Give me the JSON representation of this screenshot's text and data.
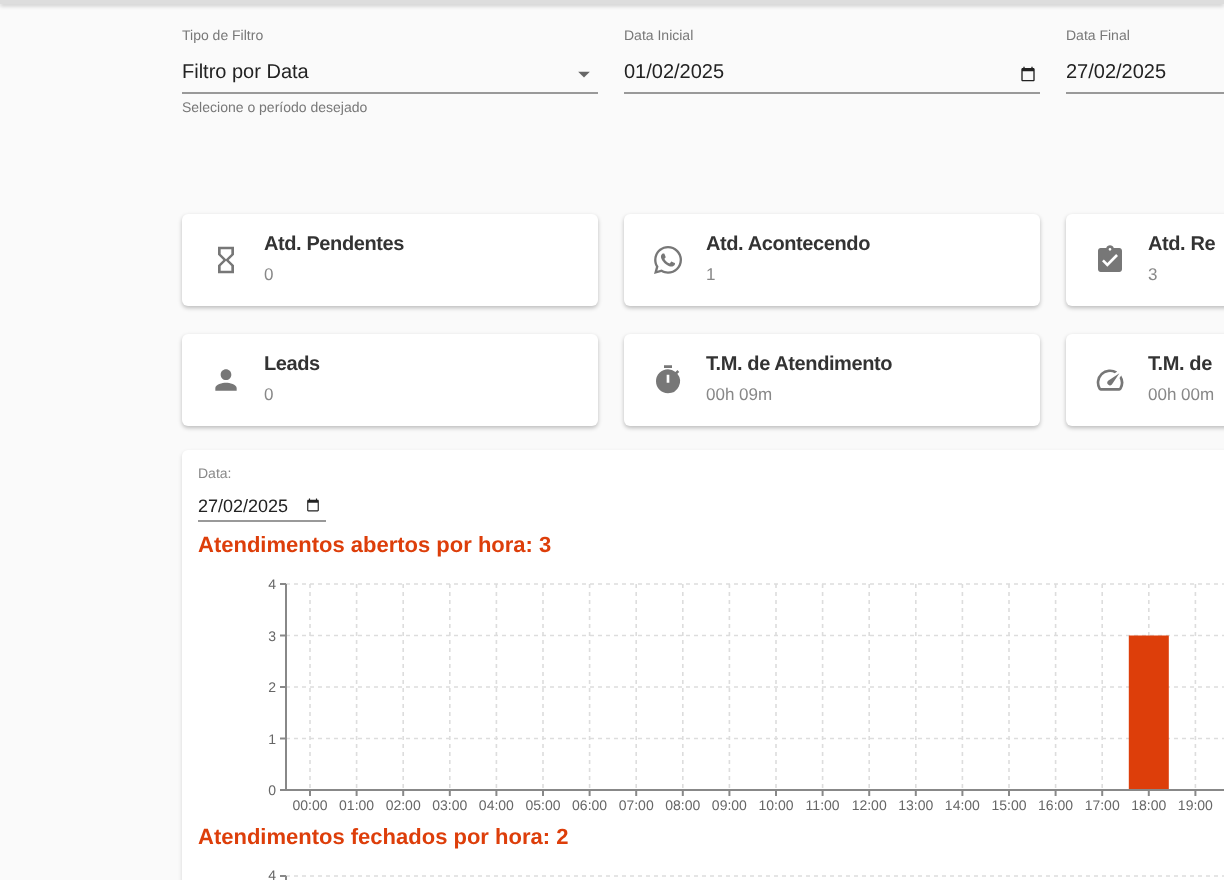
{
  "filters": [
    {
      "kind": "select",
      "label": "Tipo de Filtro",
      "value": "Filtro por Data",
      "helper": "Selecione o período desejado"
    },
    {
      "kind": "date",
      "label": "Data Inicial",
      "value": "01/02/2025"
    },
    {
      "kind": "date",
      "label": "Data Final",
      "value": "27/02/2025"
    }
  ],
  "cards": [
    {
      "title": "Atd. Pendentes",
      "value": "0"
    },
    {
      "title": "Atd. Acontecendo",
      "value": "1"
    },
    {
      "title": "Atd. Re",
      "value": "3"
    },
    {
      "title": "Leads",
      "value": "0"
    },
    {
      "title": "T.M. de Atendimento",
      "value": "00h 09m"
    },
    {
      "title": "T.M. de",
      "value": "00h 00m"
    }
  ],
  "panel": {
    "date_label": "Data:",
    "date_value": "27/02/2025",
    "charts": [
      {
        "title": "Atendimentos abertos por hora: 3",
        "chart_data": {
          "type": "bar",
          "categories": [
            "00:00",
            "01:00",
            "02:00",
            "03:00",
            "04:00",
            "05:00",
            "06:00",
            "07:00",
            "08:00",
            "09:00",
            "10:00",
            "11:00",
            "12:00",
            "13:00",
            "14:00",
            "15:00",
            "16:00",
            "17:00",
            "18:00",
            "19:00"
          ],
          "series": [
            {
              "color": "#dd3e0a",
              "values": [
                0,
                0,
                0,
                0,
                0,
                0,
                0,
                0,
                0,
                0,
                0,
                0,
                0,
                0,
                0,
                0,
                0,
                0,
                3,
                0
              ]
            }
          ],
          "ylim": [
            0,
            4
          ],
          "grid": true,
          "yticks": [
            0,
            1,
            2,
            3,
            4
          ]
        }
      },
      {
        "title": "Atendimentos fechados por hora: 2",
        "y_tick_labels": [
          "4"
        ]
      }
    ]
  }
}
